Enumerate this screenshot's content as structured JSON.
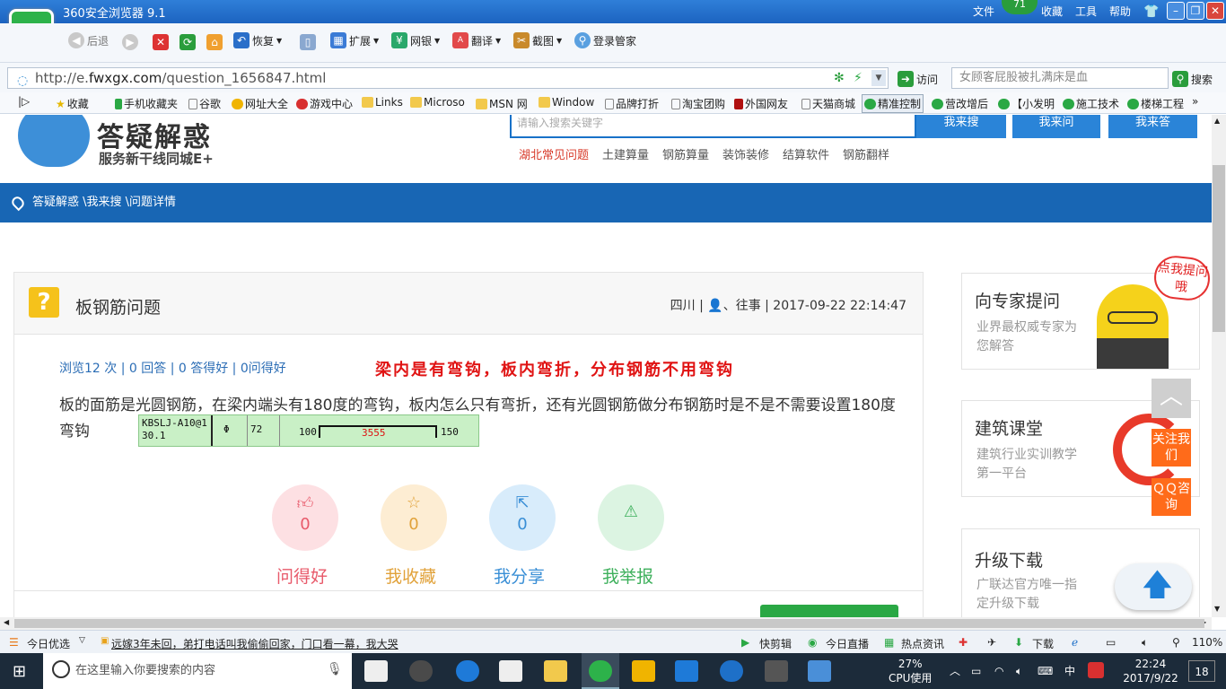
{
  "browser": {
    "title": "360安全浏览器 9.1",
    "menu": {
      "file": "文件",
      "badge": "71",
      "fav": "收藏",
      "tools": "工具",
      "help": "帮助"
    },
    "toolbar": {
      "back": "后退",
      "restore": "恢复",
      "extend": "扩展",
      "bank": "网银",
      "translate": "翻译",
      "screenshot": "截图",
      "login": "登录管家"
    },
    "address": {
      "url_prefix": "http://e.",
      "url_domain": "fwxgx.com",
      "url_path": "/question_1656847.html",
      "visit": "访问",
      "search_placeholder": "女顾客屁股被扎满床是血",
      "search_btn": "搜索"
    },
    "favorites": [
      "收藏",
      "手机收藏夹",
      "谷歌",
      "网址大全",
      "游戏中心",
      "Links",
      "Microso",
      "MSN 网",
      "Window",
      "品牌打折",
      "淘宝团购",
      "外国网友",
      "天猫商城",
      "精准控制",
      "营改增后",
      "【小发明",
      "施工技术",
      "楼梯工程"
    ]
  },
  "site": {
    "logo_text": "答疑解惑",
    "logo_sub": "服务新干线同城E+",
    "search_placeholder": "请输入搜索关键字",
    "buttons": [
      "我来搜",
      "我来问",
      "我来答"
    ],
    "links": [
      "湖北常见问题",
      "土建算量",
      "钢筋算量",
      "装饰装修",
      "结算软件",
      "钢筋翻样"
    ],
    "breadcrumb": "答疑解惑 \\我来搜 \\问题详情"
  },
  "question": {
    "icon": "?",
    "title": "板钢筋问题",
    "meta": "四川 | 👤、往事 | 2017-09-22 22:14:47",
    "stats": "浏览12 次 | 0 回答 | 0 答得好 | 0问得好",
    "annotation": "梁内是有弯钩，板内弯折，分布钢筋不用弯钩",
    "body": "板的面筋是光圆钢筋，在梁内端头有180度的弯钩，板内怎么只有弯折，还有光圆钢筋做分布钢筋时是不是不需要设置180度弯钩",
    "cad": {
      "id": "KBSLJ-A10@1",
      "id2": "30.1",
      "sym": "Φ",
      "num": "72",
      "left": "100",
      "mid": "3555",
      "right": "150"
    },
    "actions": [
      {
        "count": "0",
        "label": "问得好",
        "color": "#e8596a",
        "bg": "#fde0e3",
        "icon": "thumbs-up-icon"
      },
      {
        "count": "0",
        "label": "我收藏",
        "color": "#e1a23a",
        "bg": "#fdedd3",
        "icon": "star-icon"
      },
      {
        "count": "0",
        "label": "我分享",
        "color": "#3a8fd6",
        "bg": "#d8ecfb",
        "icon": "share-icon"
      },
      {
        "count": "0",
        "label": "我举报",
        "color": "#3eb05c",
        "bg": "#dcf4e2",
        "icon": "warning-icon"
      }
    ]
  },
  "sidebar": {
    "bubble": "点我提问哦",
    "cards": [
      {
        "title": "向专家提问",
        "desc": "业界最权威专家为您解答"
      },
      {
        "title": "建筑课堂",
        "desc": "建筑行业实训教学第一平台"
      },
      {
        "title": "升级下载",
        "desc": "广联达官方唯一指定升级下载"
      }
    ],
    "float": {
      "up": "︿",
      "follow": "关注我们",
      "qq": "ＱＱ咨询"
    }
  },
  "statusbar": {
    "today": "今日优选",
    "news": "远嫁3年未回，弟打电话叫我偷偷回家，门口看一幕，我大哭",
    "clip": "快剪辑",
    "live": "今日直播",
    "hot": "热点资讯",
    "download": "下载",
    "zoom": "110%"
  },
  "taskbar": {
    "search_placeholder": "在这里输入你要搜索的内容",
    "cpu_pct": "27%",
    "cpu_label": "CPU使用",
    "ime": "中",
    "time": "22:24",
    "date": "2017/9/22",
    "notif": "18"
  }
}
